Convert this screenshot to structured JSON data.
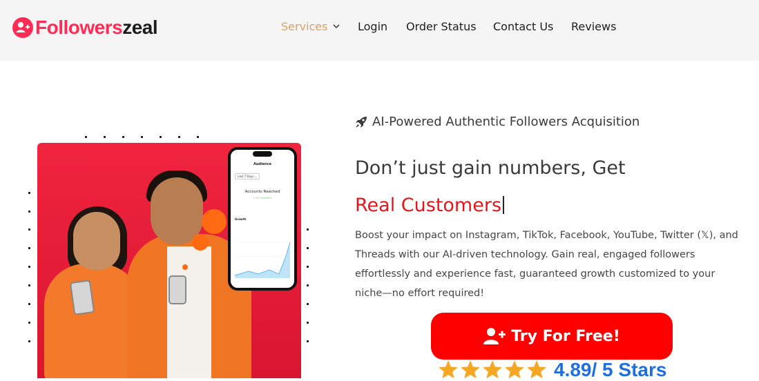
{
  "brand": {
    "name_part1": "Followers",
    "name_part2": "zeal",
    "accent": "#ff2d55"
  },
  "nav": {
    "items": [
      {
        "label": "Services",
        "has_dropdown": true,
        "active_color": "#d9a064"
      },
      {
        "label": "Login"
      },
      {
        "label": "Order Status"
      },
      {
        "label": "Contact Us"
      },
      {
        "label": "Reviews"
      }
    ]
  },
  "hero": {
    "tagline": "AI-Powered Authentic Followers Acquisition",
    "tagline_icon": "rocket-icon",
    "headline_line1": "Don’t just gain numbers, Get",
    "headline_line2": "Real Customers",
    "headline_accent": "#e2171b",
    "description": "Boost your impact on Instagram, TikTok, Facebook, YouTube, Twitter (𝕏), and Threads with our AI-driven technology. Gain real, engaged followers effortlessly and experience fast, guaranteed growth customized to your niche—no effort required!",
    "cta_label": "Try For Free!",
    "cta_icon": "user-plus-icon",
    "cta_color": "#ff0000",
    "rating_text": "4.89/ 5 Stars",
    "rating_stars": 5,
    "rating_color": "#1f6fe0"
  },
  "phone_mock": {
    "title": "Audience",
    "range": "Last 7 Days ⌄",
    "metric": "Accounts Reached",
    "sub": "1,517 followers",
    "section": "Growth"
  }
}
